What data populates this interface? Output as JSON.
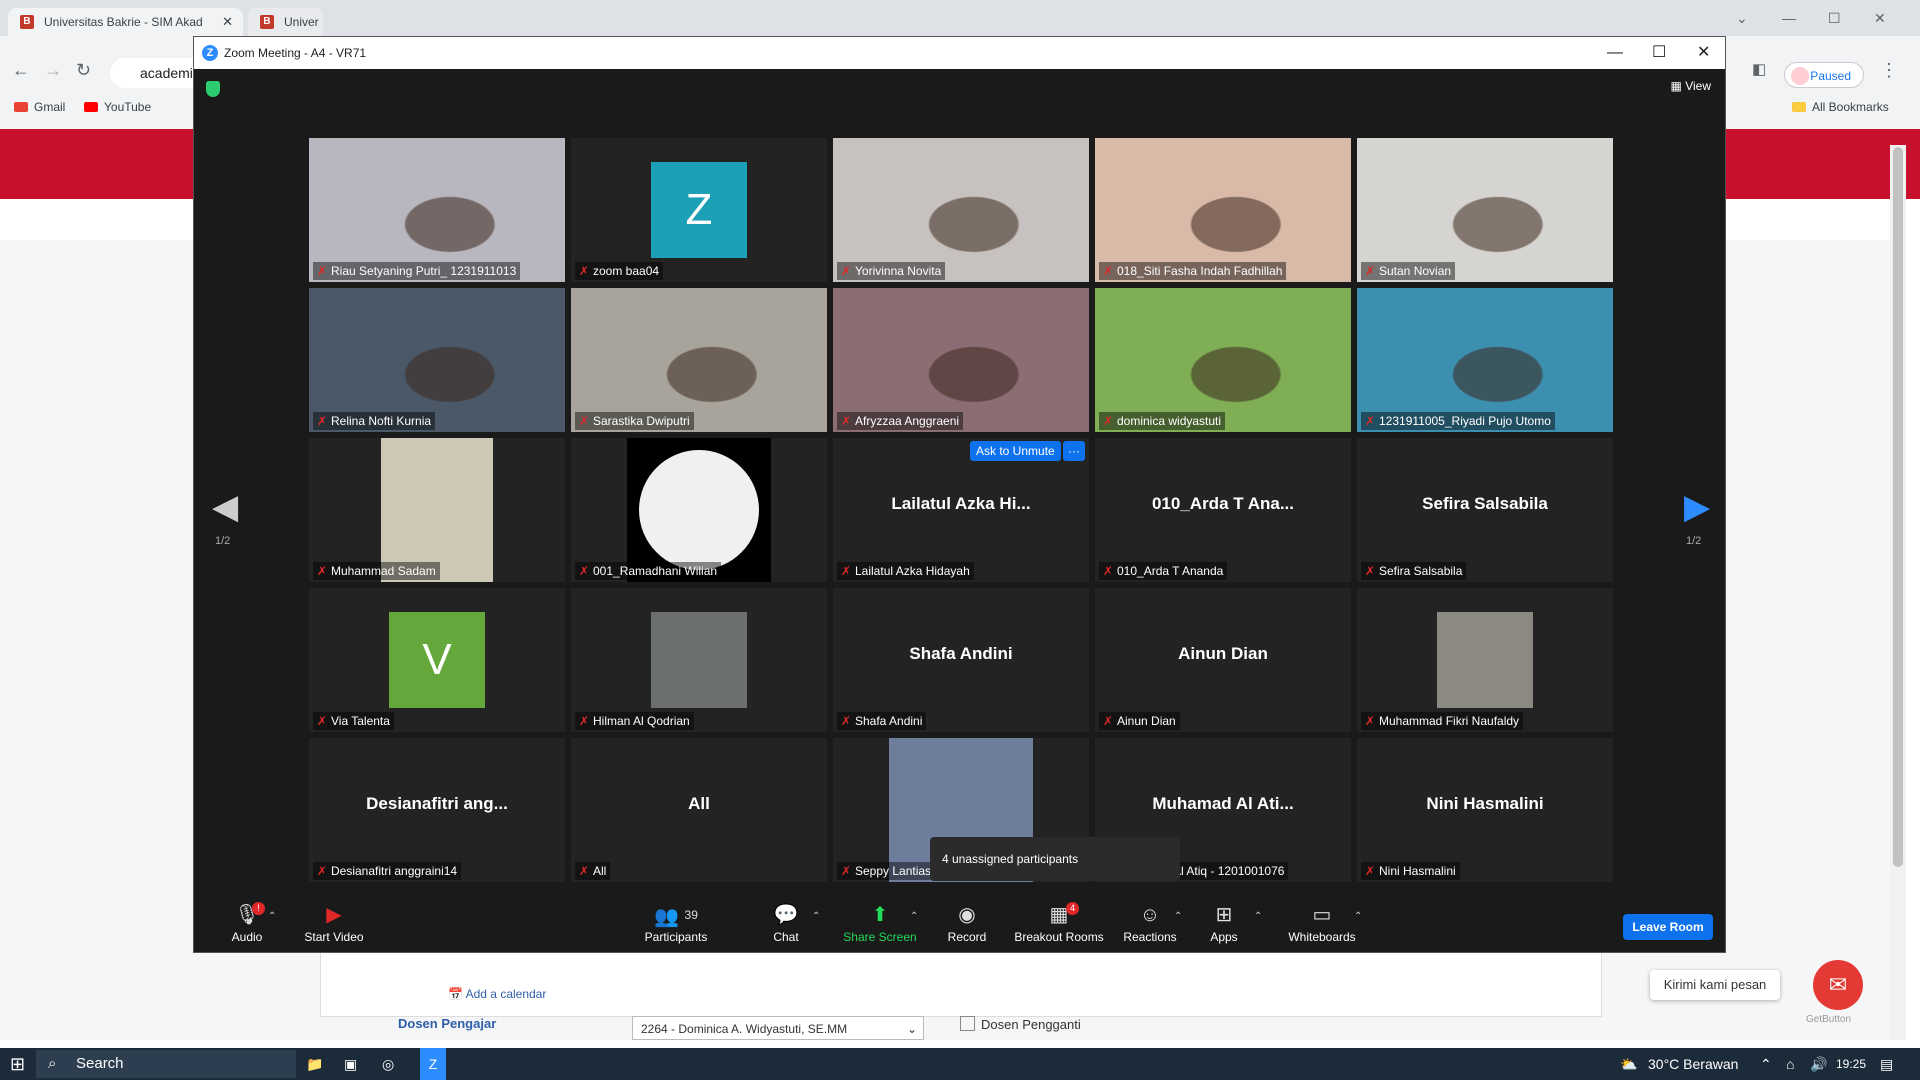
{
  "browser": {
    "tabs": [
      {
        "label": "Universitas Bakrie - SIM Akad"
      },
      {
        "label": "Univer"
      }
    ],
    "omnibox": "academi",
    "paused_label": "Paused",
    "bookmarks": [
      {
        "label": "Gmail",
        "color": "#ea4335"
      },
      {
        "label": "YouTube",
        "color": "#ff0000"
      }
    ],
    "all_bookmarks": "All Bookmarks"
  },
  "page": {
    "add_calendar": "Add a calendar",
    "dosen_label": "Dosen Pengajar",
    "dosen_value": "2264 - Dominica A. Widyastuti, SE.MM",
    "pengganti_label": "Dosen Pengganti",
    "chat_widget": "Kirimi kami pesan",
    "getbutton": "GetButton"
  },
  "zoom": {
    "title": "Zoom Meeting - A4 - VR71",
    "view_label": "View",
    "page_indicator": "1/2",
    "ask_unmute": "Ask to Unmute",
    "more": "···",
    "tooltip": "4 unassigned participants",
    "tiles": [
      {
        "name": "Riau Setyaning Putri_ 1231911013",
        "kind": "video",
        "bg": "#b8b6be"
      },
      {
        "name": "zoom baa04",
        "kind": "letter",
        "letter": "Z",
        "bg": "#1ba0b5"
      },
      {
        "name": "Yorivinna Novita",
        "kind": "video",
        "bg": "#c7c2bf"
      },
      {
        "name": "018_Siti Fasha Indah Fadhillah",
        "kind": "video",
        "bg": "#d9b9a8"
      },
      {
        "name": "Sutan Novian",
        "kind": "video",
        "bg": "#d6d4d0"
      },
      {
        "name": "Relina Nofti Kurnia",
        "kind": "video",
        "bg": "#4a5868"
      },
      {
        "name": "Sarastika Dwiputri",
        "kind": "video",
        "bg": "#a8a49c"
      },
      {
        "name": "Afryzzaa Anggraeni",
        "kind": "video",
        "bg": "#8c6d74"
      },
      {
        "name": "dominica widyastuti",
        "kind": "video",
        "bg": "#7fae55",
        "active": true
      },
      {
        "name": "1231911005_Riyadi Pujo Utomo",
        "kind": "video",
        "bg": "#3d8fb0"
      },
      {
        "name": "Muhammad Sadam",
        "kind": "photo",
        "bg": "#cdc8b6"
      },
      {
        "name": "001_Ramadhani Wilian",
        "kind": "circle",
        "bg": "#f0f0f0"
      },
      {
        "name": "Lailatul Azka Hidayah",
        "kind": "text",
        "big": "Lailatul Azka Hi..."
      },
      {
        "name": "010_Arda T Ananda",
        "kind": "text",
        "big": "010_Arda T Ana..."
      },
      {
        "name": "Sefira Salsabila",
        "kind": "text",
        "big": "Sefira Salsabila"
      },
      {
        "name": "Via Talenta",
        "kind": "letter",
        "letter": "V",
        "bg": "#64a73b"
      },
      {
        "name": "Hilman Al Qodrian",
        "kind": "photo",
        "bg": "#6b6f70"
      },
      {
        "name": "Shafa Andini",
        "kind": "text",
        "big": "Shafa Andini"
      },
      {
        "name": "Ainun Dian",
        "kind": "text",
        "big": "Ainun Dian"
      },
      {
        "name": "Muhammad Fikri Naufaldy",
        "kind": "photo",
        "bg": "#8c8a80"
      },
      {
        "name": "Desianafitri anggraini14",
        "kind": "text",
        "big": "Desianafitri ang..."
      },
      {
        "name": "All",
        "kind": "text",
        "big": "All"
      },
      {
        "name": "Seppy Lantias",
        "kind": "photo",
        "bg": "#6f7d9c"
      },
      {
        "name": "Muhamad Al Atiq - 1201001076",
        "kind": "text",
        "big": "Muhamad Al Ati..."
      },
      {
        "name": "Nini Hasmalini",
        "kind": "text",
        "big": "Nini Hasmalini"
      }
    ],
    "toolbar": {
      "audio": "Audio",
      "audio_badge": "!",
      "start_video": "Start Video",
      "participants": "Participants",
      "participants_count": "39",
      "chat": "Chat",
      "share": "Share Screen",
      "record": "Record",
      "breakout": "Breakout Rooms",
      "breakout_badge": "4",
      "reactions": "Reactions",
      "apps": "Apps",
      "whiteboards": "Whiteboards",
      "leave": "Leave Room"
    }
  },
  "taskbar": {
    "search": "Search",
    "weather": "30°C  Berawan",
    "time": "19:25"
  }
}
